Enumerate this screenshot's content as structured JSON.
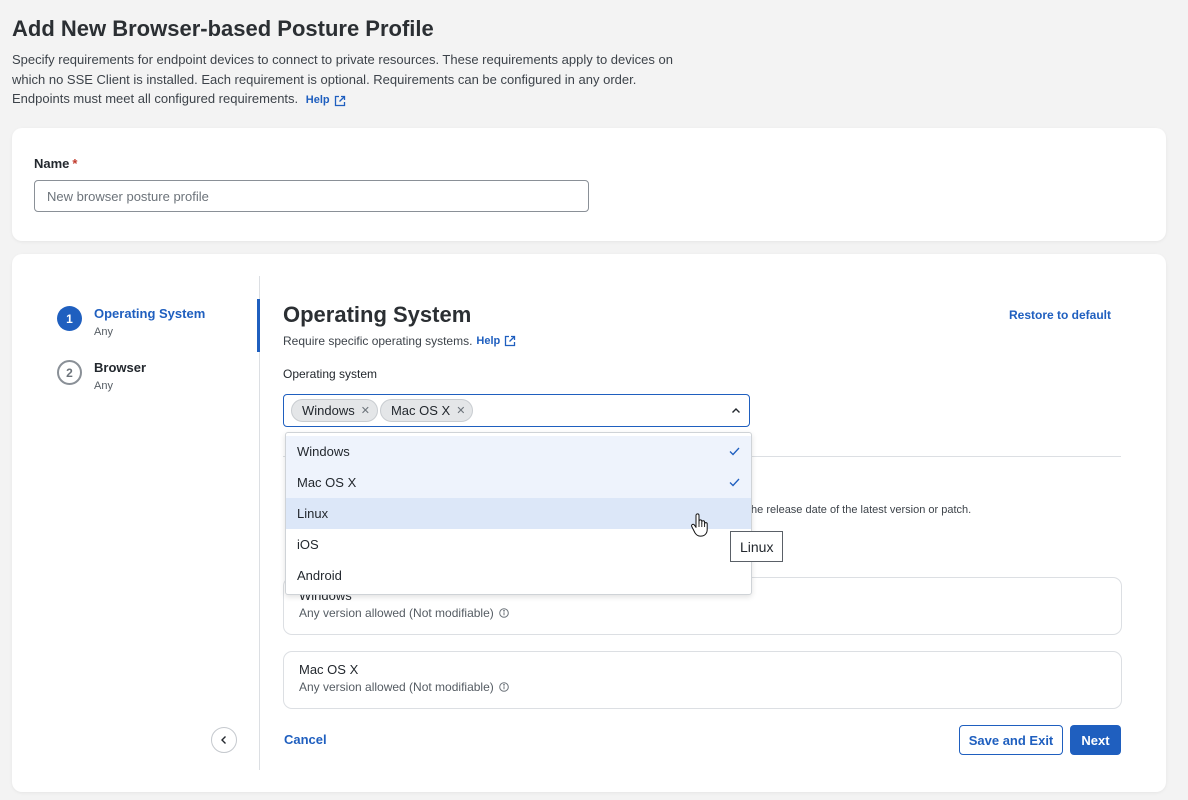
{
  "page": {
    "title": "Add New Browser-based Posture Profile",
    "description": "Specify requirements for endpoint devices to connect to private resources. These requirements apply to devices on which no SSE Client is installed. Each requirement is optional. Requirements can be configured in any order. Endpoints must meet all configured requirements.",
    "help_label": "Help"
  },
  "name_field": {
    "label": "Name",
    "required_mark": "*",
    "value": "",
    "placeholder": "New browser posture profile"
  },
  "steps": [
    {
      "number": "1",
      "title": "Operating System",
      "subtitle": "Any",
      "active": true
    },
    {
      "number": "2",
      "title": "Browser",
      "subtitle": "Any",
      "active": false
    }
  ],
  "section": {
    "title": "Operating System",
    "description": "Require specific operating systems.",
    "help_label": "Help",
    "restore_label": "Restore to default",
    "os_label": "Operating system",
    "selected_chips": [
      "Windows",
      "Mac OS X"
    ],
    "obscured_text_right": "the release date of the latest version or patch."
  },
  "dropdown": {
    "options": [
      {
        "label": "Windows",
        "checked": true
      },
      {
        "label": "Mac OS X",
        "checked": true
      },
      {
        "label": "Linux",
        "checked": false
      },
      {
        "label": "iOS",
        "checked": false
      },
      {
        "label": "Android",
        "checked": false
      }
    ],
    "tooltip": "Linux"
  },
  "os_cards": [
    {
      "name": "Windows",
      "sub": "Any version allowed (Not modifiable)"
    },
    {
      "name": "Mac OS X",
      "sub": "Any version allowed (Not modifiable)"
    }
  ],
  "footer": {
    "cancel_label": "Cancel",
    "save_exit_label": "Save and Exit",
    "next_label": "Next"
  },
  "colors": {
    "accent": "#1f5fbf",
    "background": "#f3f3f3",
    "required": "#c0392b"
  }
}
